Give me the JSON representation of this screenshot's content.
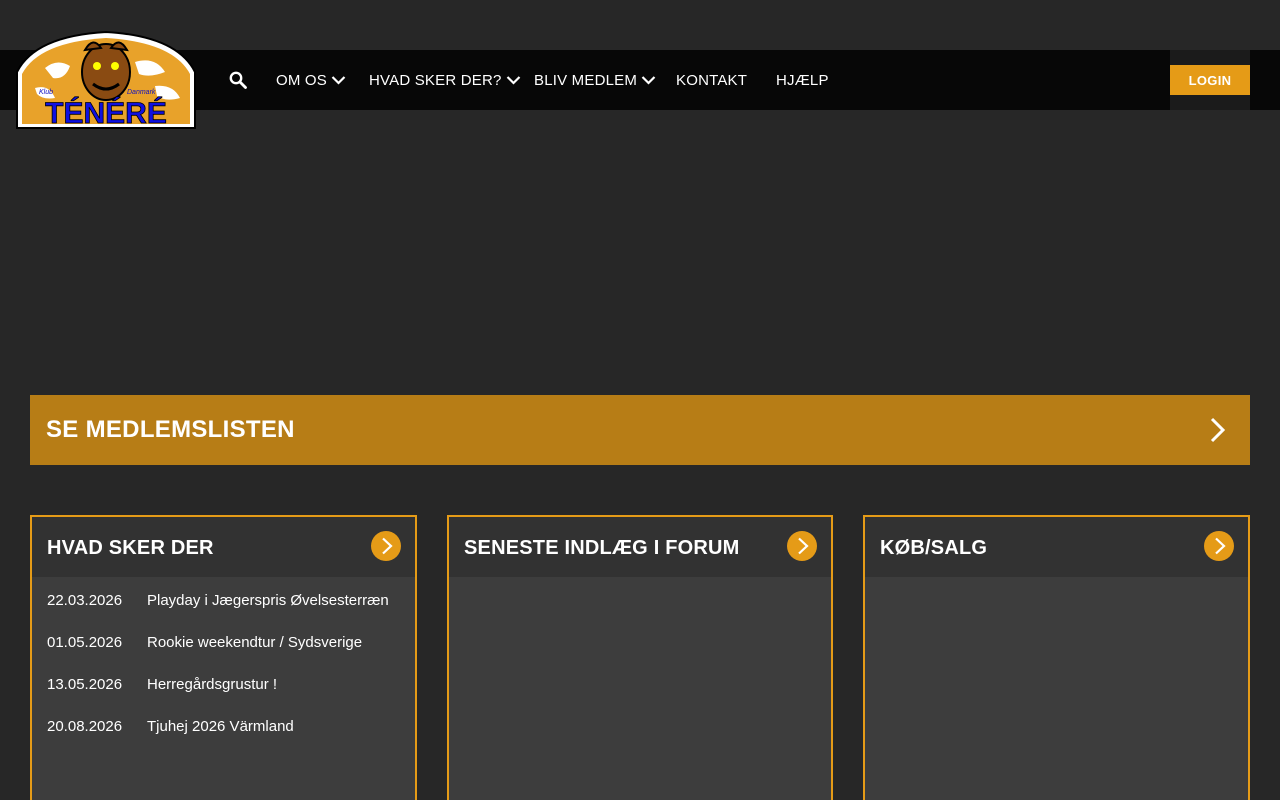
{
  "header": {
    "logo_alt": "Klub Ténéré Danmark",
    "logo_text": "TÉNÉRÉ",
    "logo_small_left": "Klub",
    "logo_small_right": "Danmark",
    "nav": [
      {
        "label": "OM OS",
        "has_dropdown": true
      },
      {
        "label": "HVAD SKER DER?",
        "has_dropdown": true
      },
      {
        "label": "BLIV MEDLEM",
        "has_dropdown": true
      },
      {
        "label": "KONTAKT",
        "has_dropdown": false
      },
      {
        "label": "HJÆLP",
        "has_dropdown": false
      }
    ],
    "login_label": "LOGIN"
  },
  "cta": {
    "label": "SE MEDLEMSLISTEN"
  },
  "cards": [
    {
      "title": "HVAD SKER DER",
      "events": [
        {
          "date": "22.03.2026",
          "title": "Playday i Jægerspris Øvelsesterræn"
        },
        {
          "date": "01.05.2026",
          "title": "Rookie weekendtur / Sydsverige"
        },
        {
          "date": "13.05.2026",
          "title": "Herregårdsgrustur !"
        },
        {
          "date": "20.08.2026",
          "title": "Tjuhej 2026 Värmland"
        }
      ]
    },
    {
      "title": "SENESTE INDLÆG I FORUM"
    },
    {
      "title": "KØB/SALG"
    }
  ],
  "colors": {
    "accent": "#e59b17",
    "cta_background": "#b77d16",
    "page_background": "#272727",
    "navbar_background": "#070707",
    "card_body": "#3d3d3d",
    "card_header": "#323232"
  }
}
